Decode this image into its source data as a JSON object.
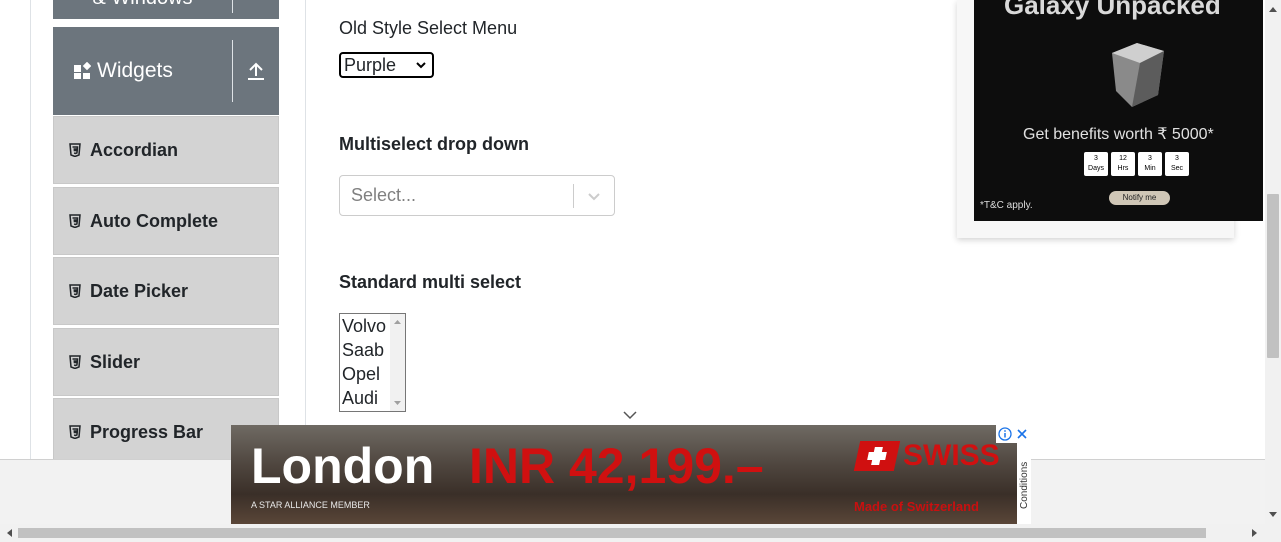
{
  "sidebar": {
    "groups": [
      {
        "label": "& Windows"
      },
      {
        "label": "Widgets"
      }
    ],
    "items": [
      {
        "label": "Accordian"
      },
      {
        "label": "Auto Complete"
      },
      {
        "label": "Date Picker"
      },
      {
        "label": "Slider"
      },
      {
        "label": "Progress Bar"
      }
    ]
  },
  "main": {
    "old_select": {
      "label": "Old Style Select Menu",
      "value": "Purple"
    },
    "multiselect_dropdown": {
      "label": "Multiselect drop down",
      "placeholder": "Select..."
    },
    "standard_multi": {
      "label": "Standard multi select",
      "options": [
        "Volvo",
        "Saab",
        "Opel",
        "Audi"
      ]
    }
  },
  "ad_right": {
    "headline": "Galaxy Unpacked",
    "benefits": "Get benefits worth ₹ 5000*",
    "timer": [
      {
        "value": "3",
        "unit": "Days"
      },
      {
        "value": "12",
        "unit": "Hrs"
      },
      {
        "value": "3",
        "unit": "Min"
      },
      {
        "value": "3",
        "unit": "Sec"
      }
    ],
    "terms": "*T&C apply.",
    "notify": "Notify me"
  },
  "ad_bottom": {
    "city": "London",
    "price": "INR 42,199.–",
    "brand": "SWISS",
    "alliance": "A STAR ALLIANCE MEMBER",
    "tagline": "Made of Switzerland",
    "conditions": "Conditions"
  },
  "colors": {
    "sidebar_header": "#6c757d",
    "sidebar_item": "#d3d3d3",
    "ad_red": "#d01010"
  }
}
